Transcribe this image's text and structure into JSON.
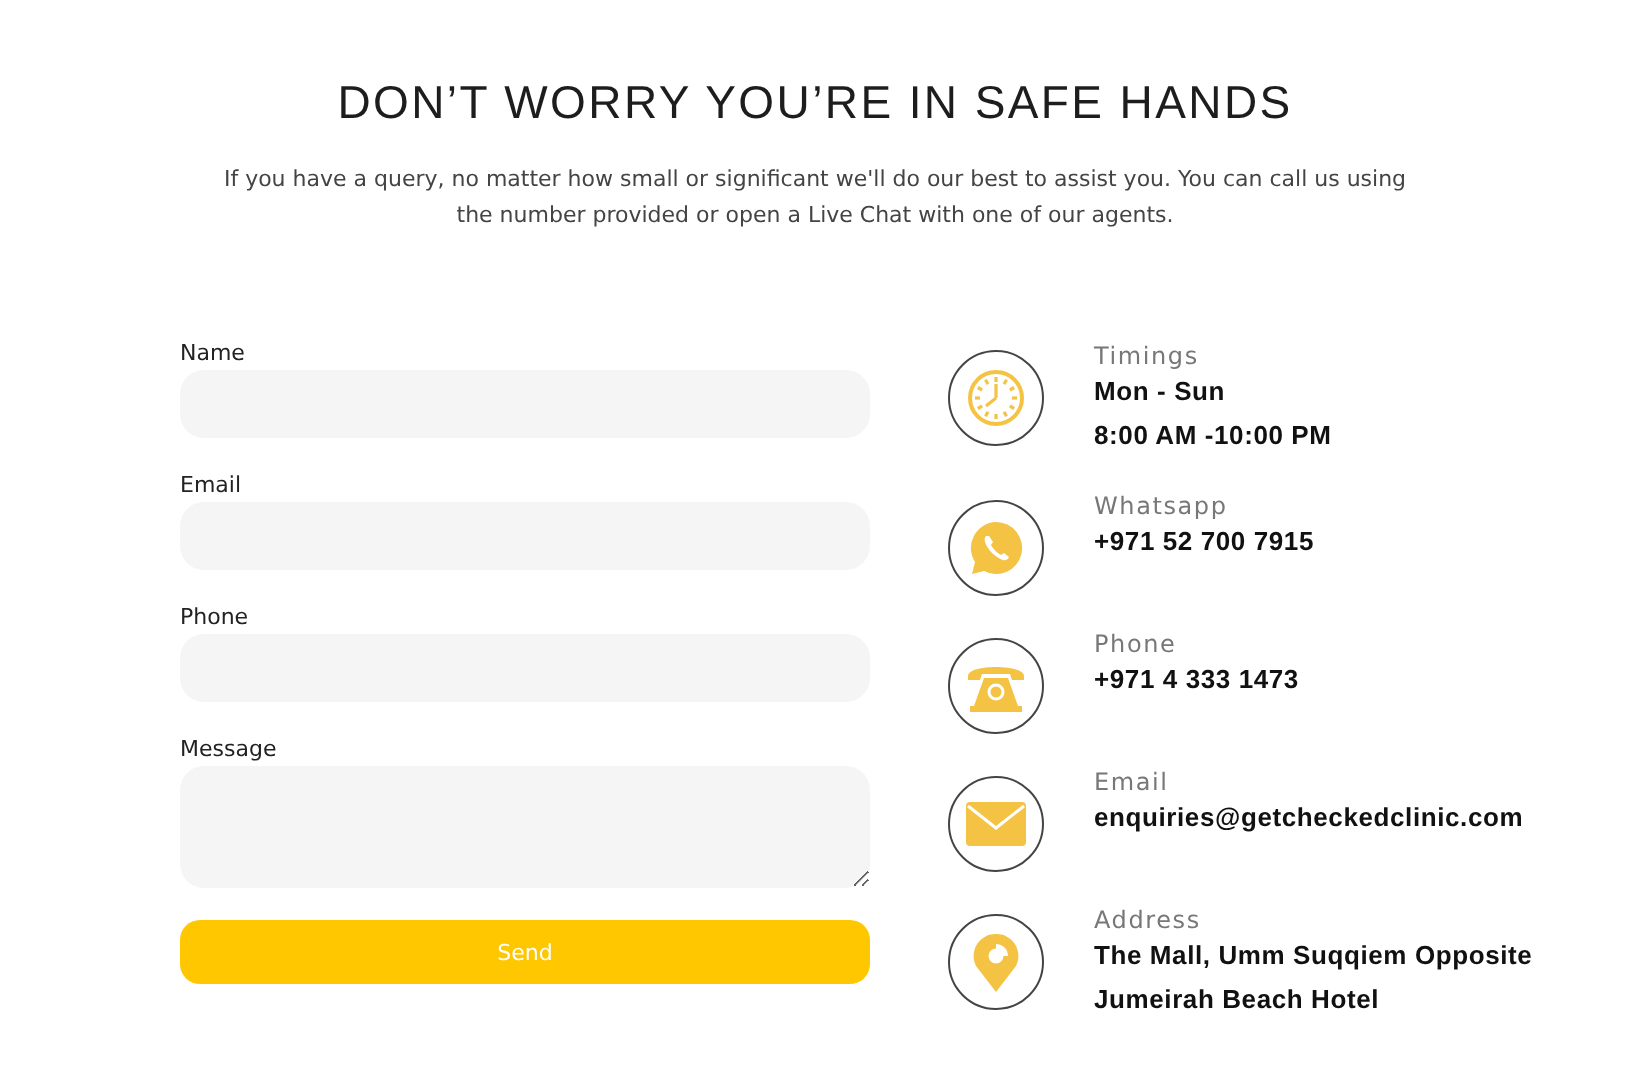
{
  "heading": "DON’T WORRY YOU’RE IN SAFE HANDS",
  "intro": "If you have a query, no matter how small or significant we'll do our best to assist you. You can call us using the number provided or open a Live Chat with one of our agents.",
  "form": {
    "fields": [
      {
        "label": "Name",
        "kind": "input"
      },
      {
        "label": "Email",
        "kind": "input"
      },
      {
        "label": "Phone",
        "kind": "input"
      },
      {
        "label": "Message",
        "kind": "textarea"
      }
    ],
    "submit": "Send"
  },
  "contacts": [
    {
      "kind": "clock",
      "label": "Timings",
      "lines": [
        "Mon - Sun",
        "8:00 AM -10:00 PM"
      ]
    },
    {
      "kind": "whatsapp",
      "label": "Whatsapp",
      "lines": [
        "+971 52 700 7915"
      ]
    },
    {
      "kind": "phone",
      "label": "Phone",
      "lines": [
        "+971 4 333 1473"
      ]
    },
    {
      "kind": "email",
      "label": "Email",
      "lines": [
        "enquiries@getcheckedclinic.com"
      ]
    },
    {
      "kind": "pin",
      "label": "Address",
      "lines": [
        "The Mall, Umm Suqqiem Opposite",
        "Jumeirah Beach Hotel"
      ]
    }
  ]
}
